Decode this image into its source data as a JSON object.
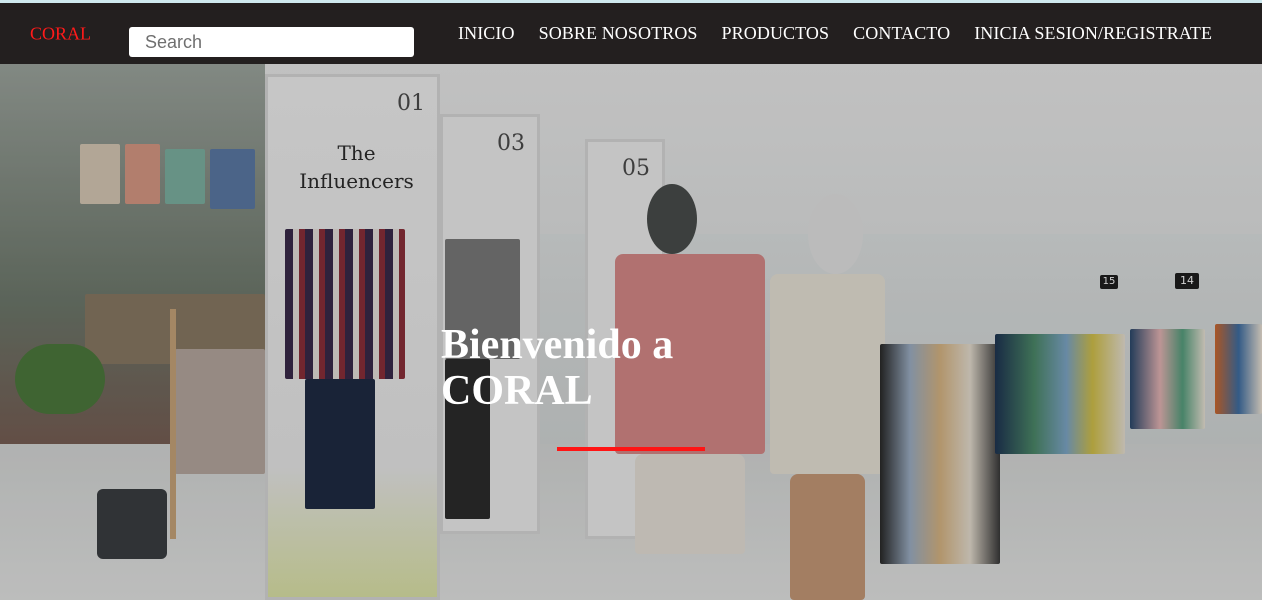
{
  "brand": {
    "name": "CORAL",
    "accent_color": "#ff1a1a"
  },
  "search": {
    "placeholder": "Search",
    "value": ""
  },
  "nav": {
    "items": [
      {
        "label": "INICIO"
      },
      {
        "label": "SOBRE NOSOTROS"
      },
      {
        "label": "PRODUCTOS"
      },
      {
        "label": "CONTACTO"
      },
      {
        "label": "INICIA SESION/REGISTRATE"
      }
    ],
    "background_color": "#231f1f"
  },
  "hero": {
    "line1": "Bienvenido a",
    "line2": "CORAL",
    "underline_color": "#ff1414",
    "panels": [
      {
        "number": "01",
        "title": "The Influencers"
      },
      {
        "number": "03",
        "title": ""
      },
      {
        "number": "05",
        "title": ""
      }
    ],
    "signs": [
      "15",
      "14"
    ]
  }
}
